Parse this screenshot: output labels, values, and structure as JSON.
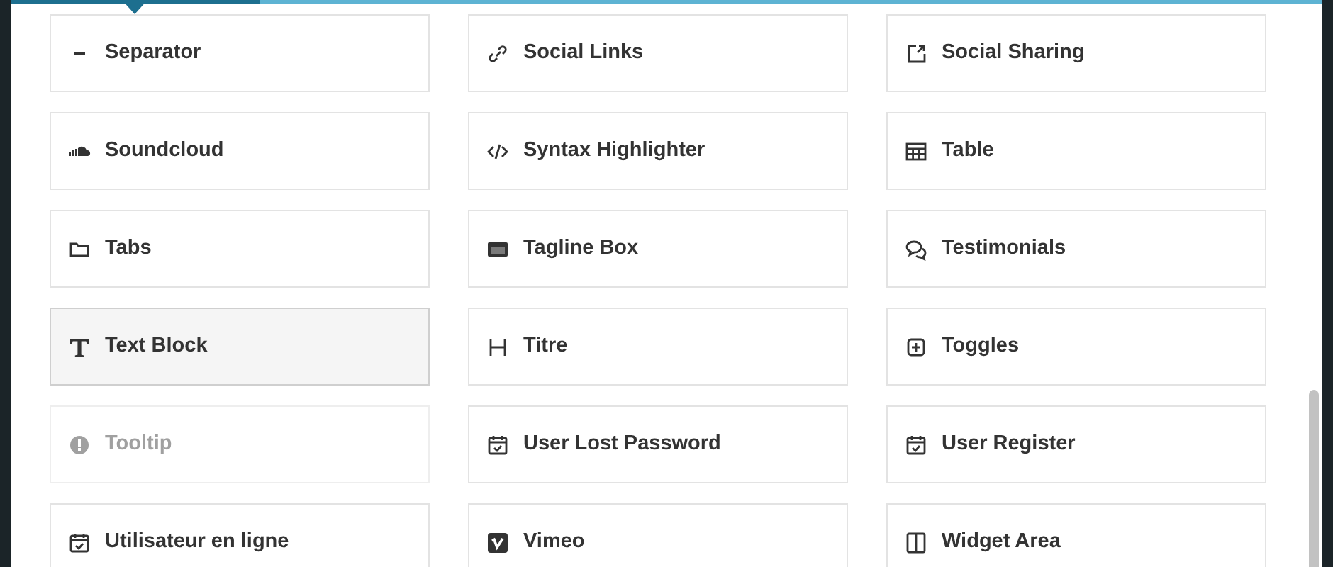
{
  "elements": [
    {
      "label": "Separator",
      "kind": "separator",
      "highlighted": false,
      "disabled": false
    },
    {
      "label": "Social Links",
      "kind": "link",
      "highlighted": false,
      "disabled": false
    },
    {
      "label": "Social Sharing",
      "kind": "share",
      "highlighted": false,
      "disabled": false
    },
    {
      "label": "Soundcloud",
      "kind": "soundcloud",
      "highlighted": false,
      "disabled": false
    },
    {
      "label": "Syntax Highlighter",
      "kind": "code",
      "highlighted": false,
      "disabled": false
    },
    {
      "label": "Table",
      "kind": "table",
      "highlighted": false,
      "disabled": false
    },
    {
      "label": "Tabs",
      "kind": "folder",
      "highlighted": false,
      "disabled": false
    },
    {
      "label": "Tagline Box",
      "kind": "tagline",
      "highlighted": false,
      "disabled": false
    },
    {
      "label": "Testimonials",
      "kind": "chat",
      "highlighted": false,
      "disabled": false
    },
    {
      "label": "Text Block",
      "kind": "text",
      "highlighted": true,
      "disabled": false
    },
    {
      "label": "Titre",
      "kind": "heading",
      "highlighted": false,
      "disabled": false
    },
    {
      "label": "Toggles",
      "kind": "plus",
      "highlighted": false,
      "disabled": false
    },
    {
      "label": "Tooltip",
      "kind": "alert",
      "highlighted": false,
      "disabled": true
    },
    {
      "label": "User Lost Password",
      "kind": "calendar",
      "highlighted": false,
      "disabled": false
    },
    {
      "label": "User Register",
      "kind": "calendar",
      "highlighted": false,
      "disabled": false
    },
    {
      "label": "Utilisateur en ligne",
      "kind": "calendar",
      "highlighted": false,
      "disabled": false
    },
    {
      "label": "Vimeo",
      "kind": "vimeo",
      "highlighted": false,
      "disabled": false
    },
    {
      "label": "Widget Area",
      "kind": "widget",
      "highlighted": false,
      "disabled": false
    }
  ]
}
